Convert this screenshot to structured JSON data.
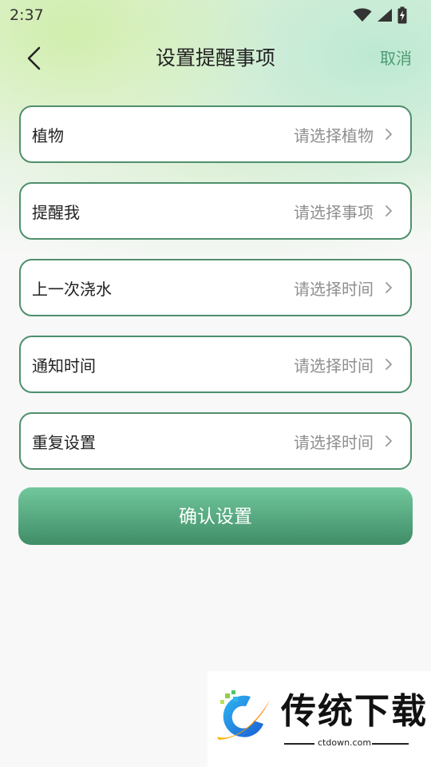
{
  "status_bar": {
    "time": "2:37",
    "icons": [
      "wifi-icon",
      "cellular-signal-icon",
      "battery-charging-icon"
    ]
  },
  "header": {
    "back_icon": "chevron-left-icon",
    "title": "设置提醒事项",
    "cancel_label": "取消"
  },
  "form": {
    "rows": [
      {
        "label": "植物",
        "value": "请选择植物"
      },
      {
        "label": "提醒我",
        "value": "请选择事项"
      },
      {
        "label": "上一次浇水",
        "value": "请选择时间"
      },
      {
        "label": "通知时间",
        "value": "请选择时间"
      },
      {
        "label": "重复设置",
        "value": "请选择时间"
      }
    ]
  },
  "confirm_label": "确认设置",
  "watermark": {
    "name": "传统下载",
    "domain": "ctdown.com"
  },
  "colors": {
    "accent": "#4e9a72",
    "row_border": "#4f8f6d",
    "button_top": "#72c79c",
    "button_bottom": "#3f8d67",
    "placeholder": "#8f8f8f"
  }
}
